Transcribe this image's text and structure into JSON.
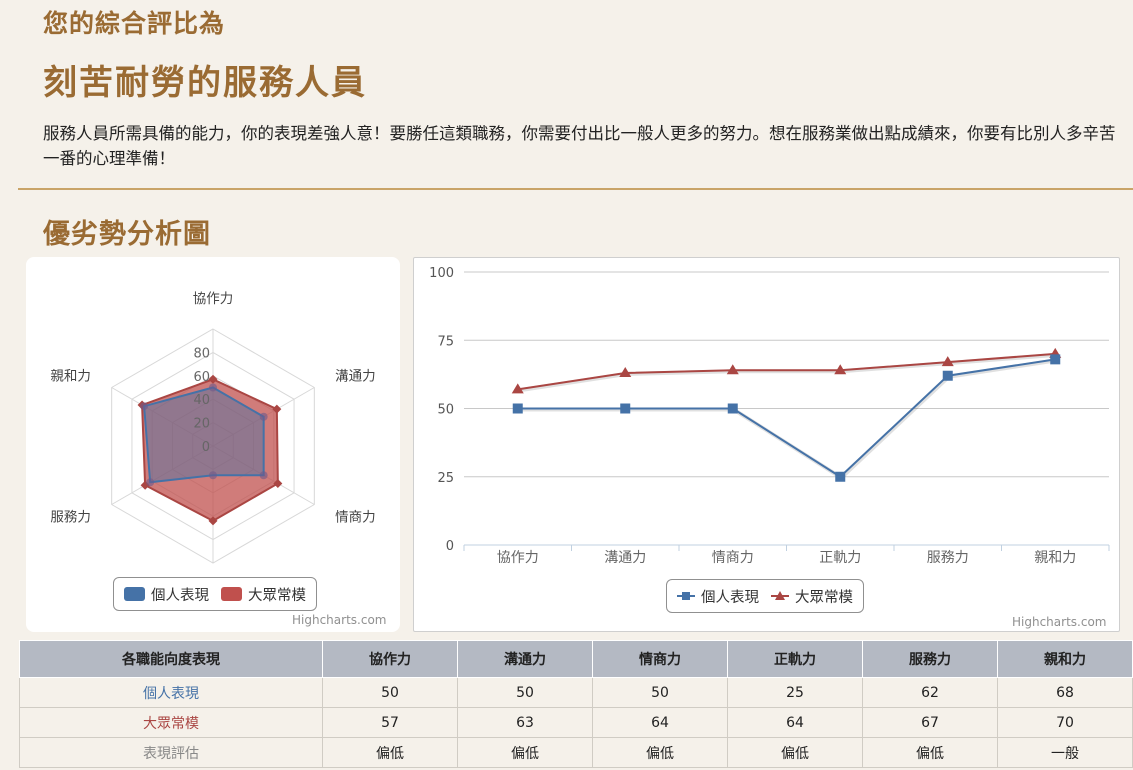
{
  "header": {
    "subtitle": "您的綜合評比為",
    "title": "刻苦耐勞的服務人員",
    "description": "服務人員所需具備的能力，你的表現差強人意！要勝任這類職務，你需要付出比一般人更多的努力。想在服務業做出點成績來，你要有比別人多辛苦一番的心理準備！"
  },
  "section_title": "優劣勢分析圖",
  "credit": "Highcharts.com",
  "colors": {
    "personal": "#4572a7",
    "average": "#aa4643",
    "heading": "#9a6b33",
    "rule": "#c9a468"
  },
  "chart_data": [
    {
      "type": "radar",
      "categories": [
        "協作力",
        "溝通力",
        "情商力",
        "正軌力",
        "服務力",
        "親和力"
      ],
      "radial_ticks": [
        "0",
        "20",
        "40",
        "60",
        "80"
      ],
      "ylim": [
        0,
        100
      ],
      "series": [
        {
          "name": "個人表現",
          "values": [
            50,
            50,
            50,
            25,
            62,
            68
          ],
          "color": "#4572a7",
          "marker": "square"
        },
        {
          "name": "大眾常模",
          "values": [
            57,
            63,
            64,
            64,
            67,
            70
          ],
          "color": "#aa4643",
          "marker": "diamond"
        }
      ],
      "legend_position": "bottom"
    },
    {
      "type": "line",
      "categories": [
        "協作力",
        "溝通力",
        "情商力",
        "正軌力",
        "服務力",
        "親和力"
      ],
      "y_ticks": [
        "0",
        "25",
        "50",
        "75",
        "100"
      ],
      "ylim": [
        0,
        100
      ],
      "grid": true,
      "series": [
        {
          "name": "個人表現",
          "values": [
            50,
            50,
            50,
            25,
            62,
            68
          ],
          "color": "#4572a7",
          "marker": "square"
        },
        {
          "name": "大眾常模",
          "values": [
            57,
            63,
            64,
            64,
            67,
            70
          ],
          "color": "#aa4643",
          "marker": "triangle"
        }
      ],
      "legend_position": "bottom"
    }
  ],
  "table": {
    "header_label": "各職能向度表現",
    "columns": [
      "協作力",
      "溝通力",
      "情商力",
      "正軌力",
      "服務力",
      "親和力"
    ],
    "rows": [
      {
        "label": "個人表現",
        "values": [
          "50",
          "50",
          "50",
          "25",
          "62",
          "68"
        ]
      },
      {
        "label": "大眾常模",
        "values": [
          "57",
          "63",
          "64",
          "64",
          "67",
          "70"
        ]
      },
      {
        "label": "表現評估",
        "values": [
          "偏低",
          "偏低",
          "偏低",
          "偏低",
          "偏低",
          "一般"
        ]
      }
    ]
  }
}
